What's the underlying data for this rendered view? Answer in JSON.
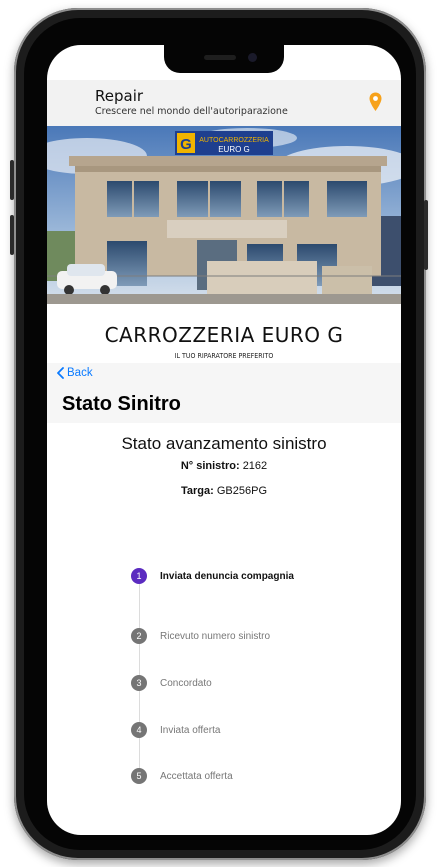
{
  "app": {
    "title": "Repair",
    "subtitle": "Crescere nel mondo dell'autoriparazione",
    "accent_color": "#f7a21b"
  },
  "banner": {
    "sign_text": "AUTOCARROZZERIA",
    "sign_subtext": "EURO G",
    "logo_letter": "G"
  },
  "company": {
    "name": "CARROZZERIA EURO G",
    "tagline": "IL TUO RIPARATORE PREFERITO"
  },
  "nav": {
    "back_label": "Back",
    "back_color": "#0a7aff"
  },
  "page": {
    "title": "Stato Sinitro"
  },
  "claim": {
    "section_title": "Stato avanzamento sinistro",
    "number_label": "N° sinistro:",
    "number_value": "2162",
    "plate_label": "Targa:",
    "plate_value": "GB256PG"
  },
  "steps": [
    {
      "number": "1",
      "label": "Inviata denuncia compagnia",
      "active": true
    },
    {
      "number": "2",
      "label": "Ricevuto numero sinistro",
      "active": false
    },
    {
      "number": "3",
      "label": "Concordato",
      "active": false
    },
    {
      "number": "4",
      "label": "Inviata offerta",
      "active": false
    },
    {
      "number": "5",
      "label": "Accettata offerta",
      "active": false
    }
  ],
  "colors": {
    "active_step": "#5b2bc0",
    "inactive_step": "#757575"
  }
}
